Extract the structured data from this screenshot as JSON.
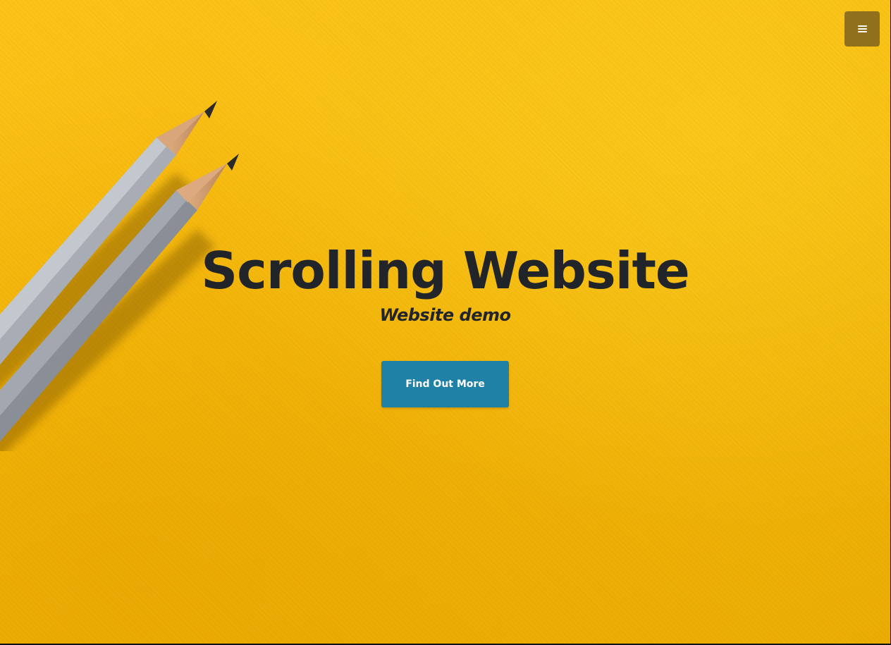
{
  "hero": {
    "title": "Scrolling Website",
    "subtitle": "Website demo",
    "cta_label": "Find Out More",
    "background_color": "#f7bb0e",
    "background_image": "two pencils on yellow paper"
  },
  "nav": {
    "menu_icon": "hamburger-menu-icon"
  },
  "colors": {
    "cta": "#1e81a5",
    "text": "#212529",
    "menu_button": "#6e561e"
  }
}
